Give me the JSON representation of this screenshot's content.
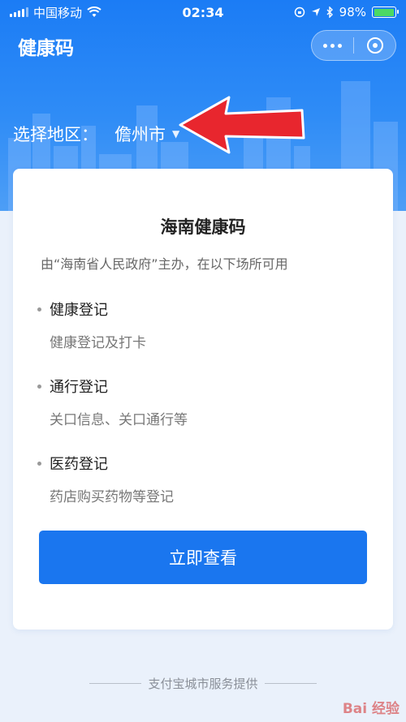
{
  "status_bar": {
    "carrier": "中国移动",
    "time": "02:34",
    "battery": "98%"
  },
  "header": {
    "title": "健康码"
  },
  "region": {
    "label": "选择地区：",
    "value": "儋州市"
  },
  "card": {
    "title": "海南健康码",
    "subtitle": "由“海南省人民政府”主办，在以下场所可用",
    "features": [
      {
        "title": "健康登记",
        "desc": "健康登记及打卡"
      },
      {
        "title": "通行登记",
        "desc": "关口信息、关口通行等"
      },
      {
        "title": "医药登记",
        "desc": "药店购买药物等登记"
      }
    ],
    "button": "立即查看"
  },
  "footer": {
    "text": "支付宝城市服务提供"
  },
  "watermark": {
    "text": "Bai 经验"
  },
  "colors": {
    "primary": "#1a76ef",
    "arrow": "#e8262e"
  }
}
